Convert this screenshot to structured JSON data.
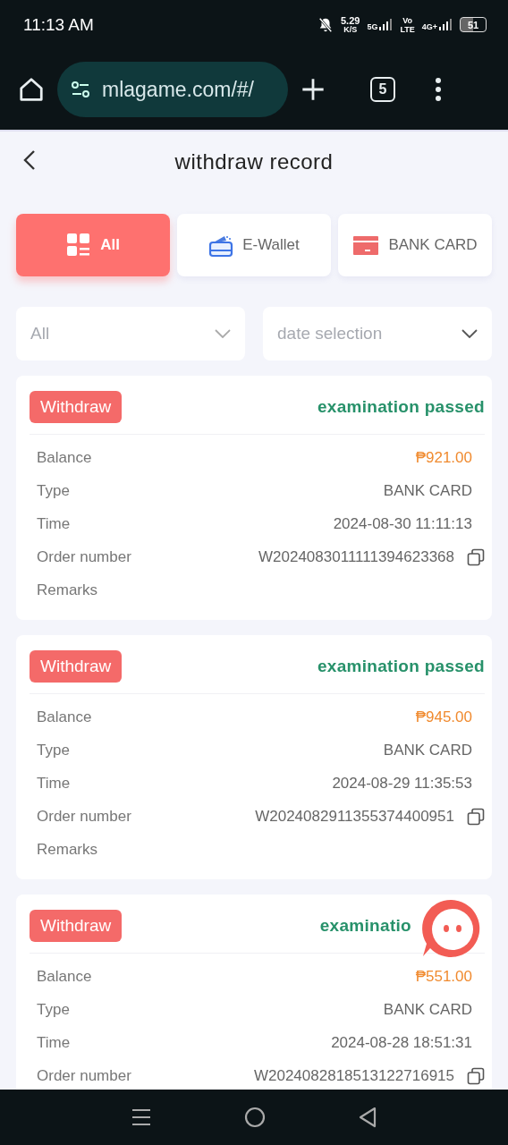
{
  "status_bar": {
    "time": "11:13 AM",
    "speed": "5.29",
    "speed_unit": "K/S",
    "network_1": "5G",
    "volte_top": "Vo",
    "volte_bottom": "LTE",
    "network_2": "4G+",
    "battery": "51"
  },
  "browser": {
    "url": "mlagame.com/#/",
    "tab_count": "5"
  },
  "header": {
    "title": "withdraw record"
  },
  "tabs": [
    {
      "label": "All",
      "selected": true
    },
    {
      "label": "E-Wallet",
      "selected": false
    },
    {
      "label": "BANK CARD",
      "selected": false
    }
  ],
  "filters": [
    {
      "placeholder": "All"
    },
    {
      "placeholder": "date selection"
    }
  ],
  "records": [
    {
      "badge": "Withdraw",
      "status": "examination passed",
      "rows": [
        {
          "kind": "amount",
          "label": "Balance",
          "value": "₱921.00"
        },
        {
          "kind": "text",
          "label": "Type",
          "value": "BANK CARD"
        },
        {
          "kind": "text",
          "label": "Time",
          "value": "2024-08-30 11:11:13"
        },
        {
          "kind": "order",
          "label": "Order number",
          "value": "W2024083011111394623368"
        },
        {
          "label": "Remarks"
        }
      ]
    },
    {
      "badge": "Withdraw",
      "status": "examination passed",
      "rows": [
        {
          "kind": "amount",
          "label": "Balance",
          "value": "₱945.00"
        },
        {
          "kind": "text",
          "label": "Type",
          "value": "BANK CARD"
        },
        {
          "kind": "text",
          "label": "Time",
          "value": "2024-08-29 11:35:53"
        },
        {
          "kind": "order",
          "label": "Order number",
          "value": "W2024082911355374400951"
        },
        {
          "label": "Remarks"
        }
      ]
    },
    {
      "badge": "Withdraw",
      "status": "examinatio",
      "rows": [
        {
          "kind": "amount",
          "label": "Balance",
          "value": "₱551.00"
        },
        {
          "kind": "text",
          "label": "Type",
          "value": "BANK CARD"
        },
        {
          "kind": "text",
          "label": "Time",
          "value": "2024-08-28 18:51:31"
        },
        {
          "kind": "order",
          "label": "Order number",
          "value": "W2024082818513122716915"
        }
      ]
    }
  ]
}
